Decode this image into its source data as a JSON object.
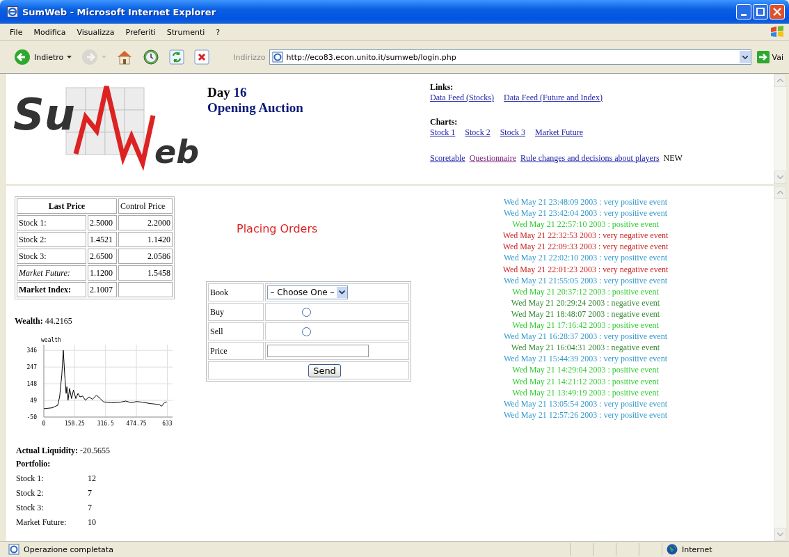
{
  "window": {
    "title": "SumWeb - Microsoft Internet Explorer"
  },
  "menu": [
    "File",
    "Modifica",
    "Visualizza",
    "Preferiti",
    "Strumenti",
    "?"
  ],
  "toolbar": {
    "buttons": [
      {
        "kind": "back",
        "label": "Indietro",
        "disabled": false
      },
      {
        "kind": "forward",
        "disabled": true
      },
      {
        "kind": "home",
        "disabled": false
      },
      {
        "kind": "history",
        "disabled": false
      },
      {
        "kind": "refresh",
        "disabled": false
      },
      {
        "kind": "stop",
        "disabled": false
      }
    ],
    "address_label": "Indirizzo",
    "address": "http://eco83.econ.unito.it/sumweb/login.php",
    "go_label": "Vai"
  },
  "logo": {
    "left": "Su",
    "right": "eb"
  },
  "header": {
    "day_label": "Day",
    "day": "16",
    "phase": "Opening Auction"
  },
  "links": {
    "heading": "Links:",
    "items": [
      {
        "text": "Data Feed (Stocks)",
        "visited": false
      },
      {
        "text": "Data Feed (Future and Index)",
        "visited": false
      }
    ]
  },
  "charts": {
    "heading": "Charts:",
    "items": [
      {
        "text": "Stock 1",
        "visited": false
      },
      {
        "text": "Stock 2",
        "visited": false
      },
      {
        "text": "Stock 3",
        "visited": false
      },
      {
        "text": "Market Future",
        "visited": false
      }
    ]
  },
  "extra_links": {
    "items": [
      {
        "text": "Scoretable",
        "visited": false
      },
      {
        "text": "Questionnaire",
        "visited": true
      },
      {
        "text": "Rule changes and decisions about players",
        "visited": false
      }
    ],
    "note": "NEW"
  },
  "price_table": {
    "columns": [
      "Last Price",
      "Control Price"
    ],
    "rows": [
      {
        "kind": "plain",
        "label": "Stock 1:",
        "last": "2.5000",
        "control": "2.2000"
      },
      {
        "kind": "plain",
        "label": "Stock 2:",
        "last": "1.4521",
        "control": "1.1420"
      },
      {
        "kind": "plain",
        "label": "Stock 3:",
        "last": "2.6500",
        "control": "2.0586"
      },
      {
        "kind": "italic",
        "label": "Market Future:",
        "last": "1.1200",
        "control": "1.5458"
      },
      {
        "kind": "bold",
        "label": "Market Index:",
        "last": "2.1007"
      }
    ]
  },
  "wealth": {
    "label": "Wealth:",
    "value": "44.2165"
  },
  "wealth_chart": {
    "chart_data": {
      "type": "line",
      "grid": true,
      "xlim": [
        0,
        660
      ],
      "ylim": [
        -50,
        380
      ],
      "xticks": [
        0,
        158.25,
        316.5,
        474.75,
        633
      ],
      "yticks": [
        -50,
        49,
        148,
        247,
        346
      ],
      "x": [
        0,
        43,
        71,
        81,
        92,
        100,
        107,
        114,
        118,
        124,
        132,
        142,
        152,
        164,
        175,
        185,
        199,
        213,
        232,
        249,
        270,
        289,
        306,
        348,
        391,
        420,
        448,
        476,
        505,
        548,
        590,
        604,
        619,
        630
      ],
      "series": [
        {
          "name": "wealth",
          "color": "#000000",
          "values": [
            0,
            5,
            20,
            70,
            200,
            346,
            200,
            90,
            130,
            50,
            120,
            60,
            110,
            60,
            90,
            70,
            75,
            50,
            70,
            55,
            80,
            60,
            40,
            35,
            38,
            45,
            35,
            42,
            38,
            30,
            25,
            15,
            35,
            40
          ]
        }
      ]
    }
  },
  "liquidity": {
    "label": "Actual Liquidity:",
    "value": "-20.5655"
  },
  "portfolio": {
    "heading": "Portfolio:",
    "rows": [
      {
        "label": "Stock 1:",
        "value": "12"
      },
      {
        "label": "Stock 2:",
        "value": "7"
      },
      {
        "label": "Stock 3:",
        "value": "7"
      },
      {
        "label": "Market Future:",
        "value": "10"
      }
    ]
  },
  "orders": {
    "title": "Placing Orders",
    "book_label": "Book",
    "book_value": "– Choose One –",
    "options": [
      {
        "label": "Buy",
        "selected": false
      },
      {
        "label": "Sell",
        "selected": false
      }
    ],
    "price_label": "Price",
    "send_label": "Send"
  },
  "events": [
    {
      "text": "Wed May 21 23:48:09 2003 : very positive event",
      "color": "#3399cc"
    },
    {
      "text": "Wed May 21 23:42:04 2003 : very positive event",
      "color": "#3399cc"
    },
    {
      "text": "Wed May 21 22:57:10 2003 : positive event",
      "color": "#33cc33"
    },
    {
      "text": "Wed May 21 22:32:53 2003 : very negative event",
      "color": "#cc2222"
    },
    {
      "text": "Wed May 21 22:09:33 2003 : very negative event",
      "color": "#cc2222"
    },
    {
      "text": "Wed May 21 22:02:10 2003 : very positive event",
      "color": "#3399cc"
    },
    {
      "text": "Wed May 21 22:01:23 2003 : very negative event",
      "color": "#cc2222"
    },
    {
      "text": "Wed May 21 21:55:05 2003 : very positive event",
      "color": "#3399cc"
    },
    {
      "text": "Wed May 21 20:37:12 2003 : positive event",
      "color": "#33cc33"
    },
    {
      "text": "Wed May 21 20:29:24 2003 : negative event",
      "color": "#338833"
    },
    {
      "text": "Wed May 21 18:48:07 2003 : negative event",
      "color": "#338833"
    },
    {
      "text": "Wed May 21 17:16:42 2003 : positive event",
      "color": "#33cc33"
    },
    {
      "text": "Wed May 21 16:28:37 2003 : very positive event",
      "color": "#3399cc"
    },
    {
      "text": "Wed May 21 16:04:31 2003 : negative event",
      "color": "#338833"
    },
    {
      "text": "Wed May 21 15:44:39 2003 : very positive event",
      "color": "#3399cc"
    },
    {
      "text": "Wed May 21 14:29:04 2003 : positive event",
      "color": "#33cc33"
    },
    {
      "text": "Wed May 21 14:21:12 2003 : positive event",
      "color": "#33cc33"
    },
    {
      "text": "Wed May 21 13:49:19 2003 : positive event",
      "color": "#33cc33"
    },
    {
      "text": "Wed May 21 13:05:54 2003 : very positive event",
      "color": "#3399cc"
    },
    {
      "text": "Wed May 21 12:57:26 2003 : very positive event",
      "color": "#3399cc"
    }
  ],
  "status_bar": {
    "message": "Operazione completata",
    "zone": "Internet"
  }
}
